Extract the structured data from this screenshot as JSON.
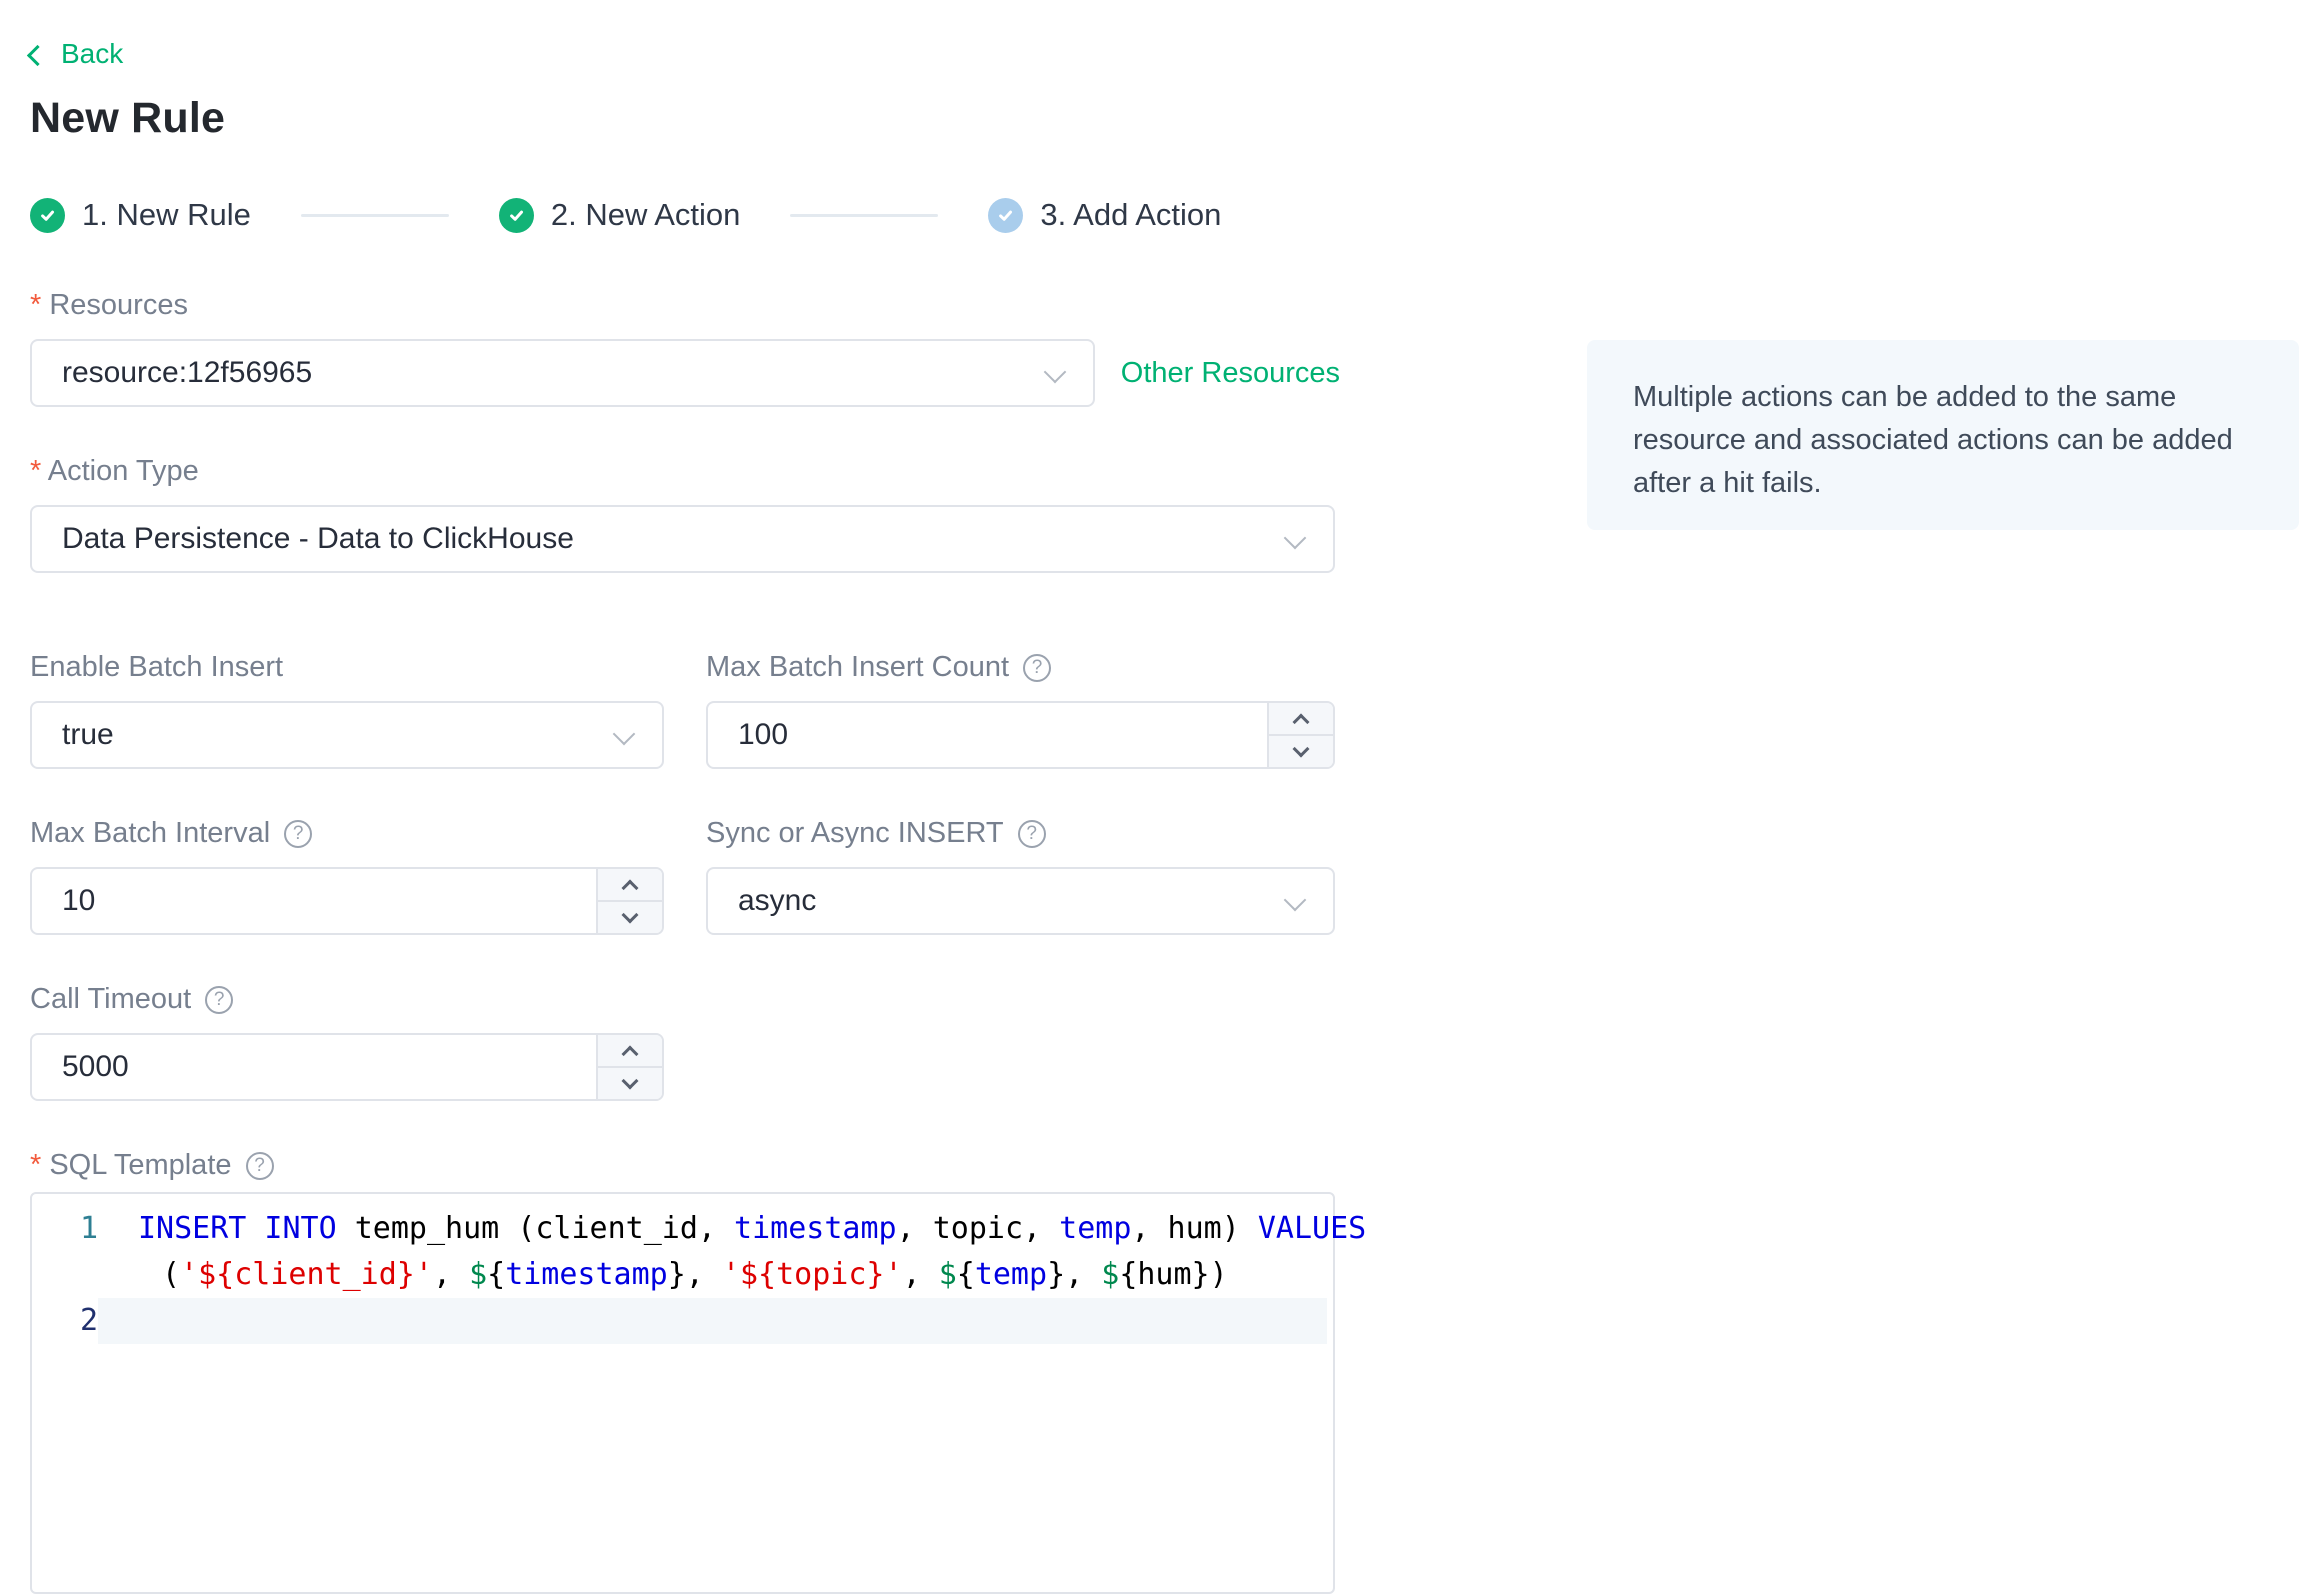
{
  "page": {
    "back_label": "Back",
    "title": "New Rule"
  },
  "steps": [
    {
      "label": "1. New Rule",
      "state": "done"
    },
    {
      "label": "2. New Action",
      "state": "done"
    },
    {
      "label": "3. Add Action",
      "state": "pending"
    }
  ],
  "form": {
    "resources": {
      "label": "Resources",
      "required": true,
      "value": "resource:12f56965",
      "side_link": "Other Resources"
    },
    "info_box_text": "Multiple actions can be added to the same resource and associated actions can be added after a hit fails.",
    "action_type": {
      "label": "Action Type",
      "required": true,
      "value": "Data Persistence - Data to ClickHouse"
    },
    "enable_batch": {
      "label": "Enable Batch Insert",
      "value": "true"
    },
    "max_batch_count": {
      "label": "Max Batch Insert Count",
      "value": "100"
    },
    "max_batch_interval": {
      "label": "Max Batch Interval",
      "value": "10"
    },
    "sync_async": {
      "label": "Sync or Async INSERT",
      "value": "async"
    },
    "call_timeout": {
      "label": "Call Timeout",
      "value": "5000"
    },
    "sql_template": {
      "label": "SQL Template",
      "required": true
    },
    "help_icon_glyph": "?"
  },
  "sql_editor": {
    "full_sql": "INSERT INTO temp_hum (client_id, timestamp, topic, temp, hum) VALUES ('${client_id}', ${timestamp}, '${topic}', ${temp}, ${hum})",
    "lines": [
      {
        "number": "1",
        "number_color": "#2e7f93",
        "active": false,
        "rows": [
          [
            {
              "c": "kw",
              "t": "INSERT INTO"
            },
            {
              "c": "pl",
              "t": " temp_hum (client_id, "
            },
            {
              "c": "kw",
              "t": "timestamp"
            },
            {
              "c": "pl",
              "t": ", topic, "
            },
            {
              "c": "kw",
              "t": "temp"
            },
            {
              "c": "pl",
              "t": ", hum) "
            },
            {
              "c": "kw",
              "t": "VALUES"
            }
          ],
          [
            {
              "c": "pl",
              "t": "("
            },
            {
              "c": "str",
              "t": "'${client_id}'"
            },
            {
              "c": "pl",
              "t": ", "
            },
            {
              "c": "var",
              "t": "$"
            },
            {
              "c": "pl",
              "t": "{"
            },
            {
              "c": "kw",
              "t": "timestamp"
            },
            {
              "c": "pl",
              "t": "}, "
            },
            {
              "c": "str",
              "t": "'${topic}'"
            },
            {
              "c": "pl",
              "t": ", "
            },
            {
              "c": "var",
              "t": "$"
            },
            {
              "c": "pl",
              "t": "{"
            },
            {
              "c": "kw",
              "t": "temp"
            },
            {
              "c": "pl",
              "t": "}, "
            },
            {
              "c": "var",
              "t": "$"
            },
            {
              "c": "pl",
              "t": "{hum})"
            }
          ]
        ]
      },
      {
        "number": "2",
        "number_color": "#20306e",
        "active": true,
        "rows": [
          []
        ]
      }
    ]
  },
  "colors": {
    "green": "#00b173",
    "step_done": "#12b377",
    "step_pending": "#a9cdec",
    "border": "#e0e3e9",
    "stepper_bg": "#f5f7fa",
    "info_bg": "#f3f8fc",
    "asterisk": "#f25a3c",
    "sql_keyword": "#0000e0",
    "sql_string": "#dd0000",
    "sql_variable": "#00884e",
    "active_line_bg": "#f3f7fa"
  }
}
